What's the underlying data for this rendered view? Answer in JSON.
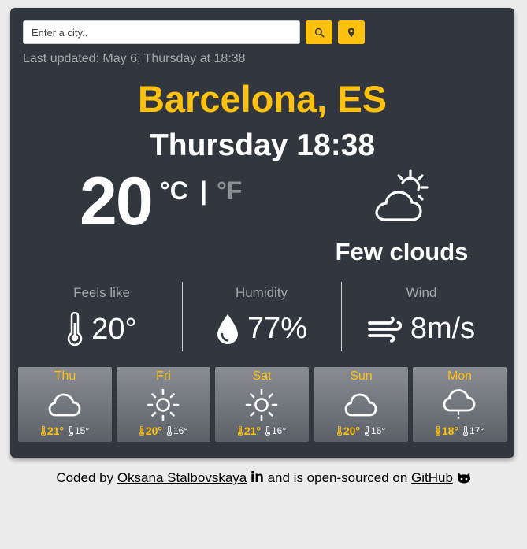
{
  "search": {
    "placeholder": "Enter a city..",
    "search_button_icon": "search-icon",
    "location_button_icon": "location-pin-icon"
  },
  "last_updated": "Last updated: May 6, Thursday at 18:38",
  "city": "Barcelona, ES",
  "datetime": "Thursday 18:38",
  "current": {
    "temperature": "20",
    "unit_c": "°C",
    "unit_separator": "|",
    "unit_f": "°F",
    "icon": "cloud-sun-icon",
    "condition": "Few clouds"
  },
  "stats": [
    {
      "label": "Feels like",
      "value": "20°",
      "icon": "thermometer-icon"
    },
    {
      "label": "Humidity",
      "value": "77%",
      "icon": "droplet-icon"
    },
    {
      "label": "Wind",
      "value": "8m/s",
      "icon": "wind-icon"
    }
  ],
  "forecast": [
    {
      "day": "Thu",
      "icon": "cloud-icon",
      "high": "21°",
      "low": "15°"
    },
    {
      "day": "Fri",
      "icon": "sun-icon",
      "high": "20°",
      "low": "16°"
    },
    {
      "day": "Sat",
      "icon": "sun-icon",
      "high": "21°",
      "low": "16°"
    },
    {
      "day": "Sun",
      "icon": "cloud-icon",
      "high": "20°",
      "low": "16°"
    },
    {
      "day": "Mon",
      "icon": "cloud-drizzle-icon",
      "high": "18°",
      "low": "17°"
    }
  ],
  "footer": {
    "prefix": "Coded by ",
    "author": "Oksana Stalbovskaya",
    "linkedin": "in",
    "middle": " and is open-sourced on ",
    "github": "GitHub"
  },
  "colors": {
    "card_bg": "#31363f",
    "accent": "#fec20e",
    "muted_text": "#a4a7ac"
  }
}
